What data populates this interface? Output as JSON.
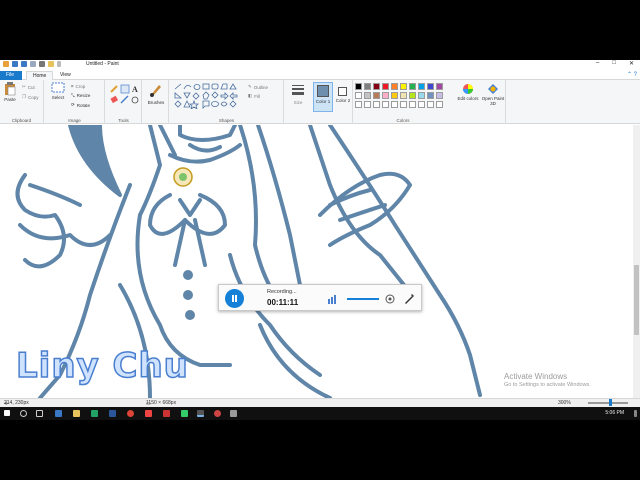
{
  "window": {
    "title": "Untitled - Paint",
    "controls": [
      "–",
      "□",
      "✕"
    ]
  },
  "tabs": [
    {
      "label": "File"
    },
    {
      "label": "Home"
    },
    {
      "label": "View"
    }
  ],
  "ribbon": {
    "clipboard": {
      "paste": "Paste",
      "cut": "Cut",
      "copy": "Copy",
      "label": "Clipboard"
    },
    "image": {
      "select": "Select",
      "crop": "Crop",
      "resize": "Resize",
      "rotate": "Rotate",
      "label": "Image"
    },
    "tools": {
      "label": "Tools"
    },
    "brushes": {
      "label": "Brushes"
    },
    "shapes": {
      "outline": "Outline",
      "fill": "Fill",
      "label": "Shapes"
    },
    "size": {
      "label": "Size"
    },
    "color1": {
      "label": "Color 1"
    },
    "color2": {
      "label": "Color 2"
    },
    "colors": {
      "label": "Colors",
      "edit": "Edit colors"
    },
    "paint3d": {
      "label": "Open Paint 3D"
    },
    "palette": [
      "#000000",
      "#7f7f7f",
      "#880015",
      "#ed1c24",
      "#ff7f27",
      "#fff200",
      "#22b14c",
      "#00a2e8",
      "#3f48cc",
      "#a349a4",
      "#ffffff",
      "#c3c3c3",
      "#b97a57",
      "#ffaec9",
      "#ffc90e",
      "#efe4b0",
      "#b5e61d",
      "#99d9ea",
      "#7092be",
      "#c8bfe7"
    ]
  },
  "statusbar": {
    "cursor": "214, 230px",
    "dimensions": "1150 × 668px",
    "zoom": "300%"
  },
  "recording": {
    "status": "Recording...",
    "time": "00:11:11"
  },
  "overlay": {
    "name": "Liny Chu",
    "activate_title": "Activate Windows",
    "activate_sub": "Go to Settings to activate Windows."
  },
  "taskbar": {
    "time": "5:06 PM"
  },
  "colors": {
    "accent": "#1979ca",
    "drawing": "#5f85a8"
  }
}
